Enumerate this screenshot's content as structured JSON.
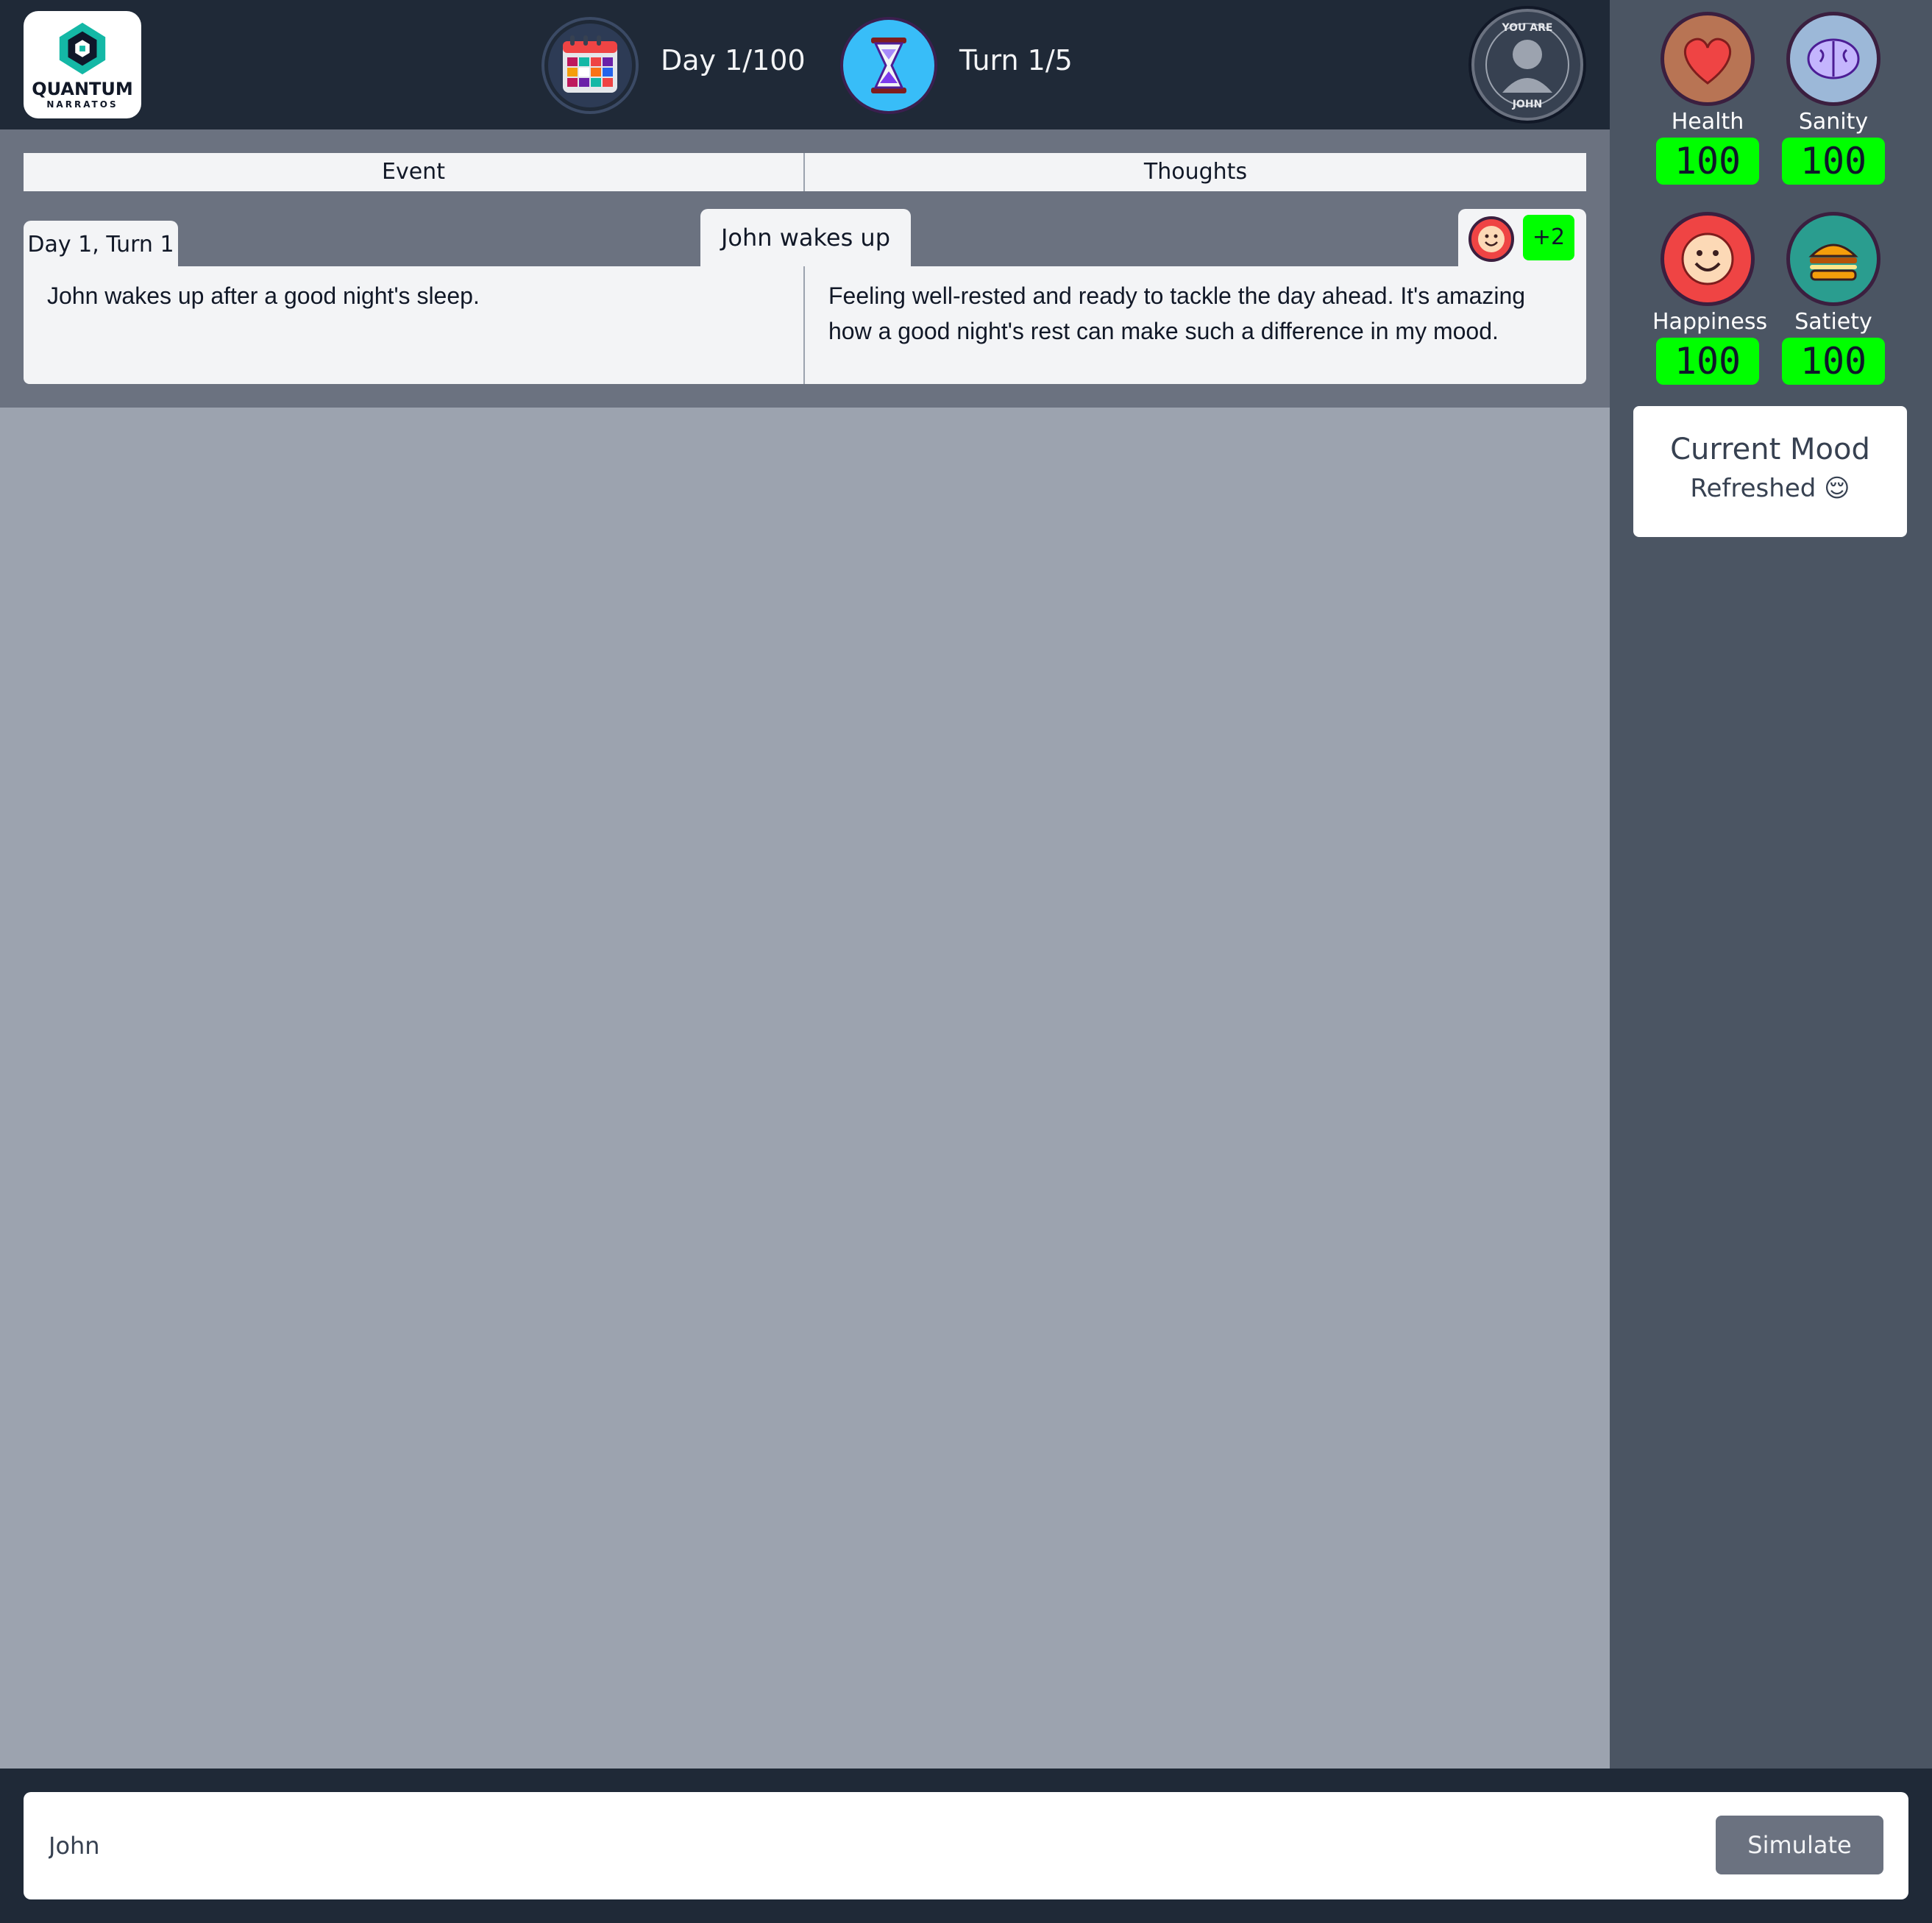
{
  "header": {
    "logo_name": "QUANTUM",
    "logo_sub": "NARRATOS",
    "day_label": "Day 1/100",
    "turn_label": "Turn 1/5",
    "avatar_top_text": "YOU ARE",
    "avatar_bottom_text": "JOHN"
  },
  "stats": {
    "health": {
      "label": "Health",
      "value": "100"
    },
    "sanity": {
      "label": "Sanity",
      "value": "100"
    },
    "happiness": {
      "label": "Happiness",
      "value": "100"
    },
    "satiety": {
      "label": "Satiety",
      "value": "100"
    }
  },
  "mood": {
    "title": "Current Mood",
    "value": "Refreshed 😌"
  },
  "log": {
    "columns": {
      "event": "Event",
      "thoughts": "Thoughts"
    },
    "entry": {
      "time": "Day 1, Turn 1",
      "title": "John wakes up",
      "effect_icon": "smiley-icon",
      "effect_value": "+2",
      "event_text": "John wakes up after a good night's sleep.",
      "thought_text": "Feeling well-rested and ready to tackle the day ahead. It's amazing how a good night's rest can make such a difference in my mood."
    }
  },
  "input": {
    "value": "John",
    "button_label": "Simulate"
  },
  "colors": {
    "topbar": "#1f2937",
    "sidebar": "#4b5563",
    "panel": "#6b7280",
    "background": "#9ca3af",
    "stat_badge": "#00ff00"
  }
}
